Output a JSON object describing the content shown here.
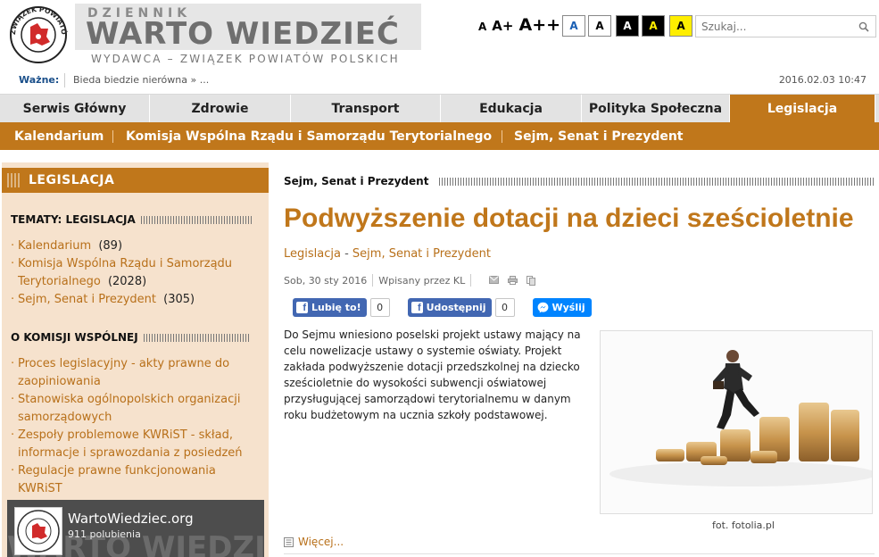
{
  "header": {
    "seal_text": "ZWIĄZEK POWIATÓW POLSKICH",
    "brand_small": "DZIENNIK",
    "brand_big": "WARTO WIEDZIEĆ",
    "brand_sub": "WYDAWCA – ZWIĄZEK POWIATÓW POLSKICH",
    "font_sizes": [
      "A",
      "A+",
      "A++"
    ],
    "contrast_options": [
      "A",
      "A",
      "A",
      "A",
      "A"
    ],
    "search_placeholder": "Szukaj..."
  },
  "ticker": {
    "label": "Ważne:",
    "text": "Bieda biedzie nierówna  »  ...",
    "datetime": "2016.02.03 10:47"
  },
  "main_nav": [
    {
      "label": "Serwis Główny",
      "active": false
    },
    {
      "label": "Zdrowie",
      "active": false
    },
    {
      "label": "Transport",
      "active": false
    },
    {
      "label": "Edukacja",
      "active": false
    },
    {
      "label": "Polityka Społeczna",
      "active": false
    },
    {
      "label": "Legislacja",
      "active": true
    }
  ],
  "sub_nav": [
    "Kalendarium",
    "Komisja Wspólna Rządu i Samorządu Terytorialnego",
    "Sejm, Senat i Prezydent"
  ],
  "sidebar": {
    "header": "LEGISLACJA",
    "section1_title": "TEMATY: LEGISLACJA",
    "topics": [
      {
        "label": "Kalendarium",
        "count": "(89)"
      },
      {
        "label": "Komisja Wspólna Rządu i Samorządu Terytorialnego",
        "count": "(2028)"
      },
      {
        "label": "Sejm, Senat i Prezydent",
        "count": "(305)"
      }
    ],
    "section2_title": "O KOMISJI WSPÓLNEJ",
    "about": [
      "Proces legislacyjny - akty prawne do zaopiniowania",
      "Stanowiska ogólnopolskich organizacji samorządowych",
      "Zespoły problemowe KWRiST - skład, informacje i sprawozdania z posiedzeń",
      "Regulacje prawne funkcjonowania KWRiST"
    ],
    "fb_widget": {
      "page_name": "WartoWiedziec.org",
      "likes": "911 polubienia",
      "bg_text": "WARTO WIEDZIEĆ"
    }
  },
  "content": {
    "section_title": "Sejm, Senat i Prezydent",
    "article_title": "Podwyższenie dotacji na dzieci sześcioletnie",
    "category_1": "Legislacja",
    "category_sep": " - ",
    "category_2": "Sejm, Senat i Prezydent",
    "date": "Sob, 30 sty 2016",
    "author": "Wpisany przez KL",
    "like_label": "Lubię to!",
    "like_count": "0",
    "share_label": "Udostępnij",
    "share_count": "0",
    "send_label": "Wyślij",
    "body": "Do Sejmu wniesiono poselski projekt ustawy mający na celu nowelizacje ustawy o systemie oświaty. Projekt zakłada podwyższenie dotacji przedszkolnej na dziecko sześcioletnie do wysokości subwencji oświatowej przysługującej samorządowi terytorialnemu w danym roku budżetowym na ucznia szkoły podstawowej.",
    "photo_credit": "fot. fotolia.pl",
    "more_label": "Więcej..."
  },
  "colors": {
    "accent": "#c0771b",
    "nav_bg": "#e3e3e3",
    "sidebar_bg": "#f6e2cd",
    "link": "#b8701a",
    "facebook": "#4267b2",
    "messenger": "#0084ff"
  }
}
